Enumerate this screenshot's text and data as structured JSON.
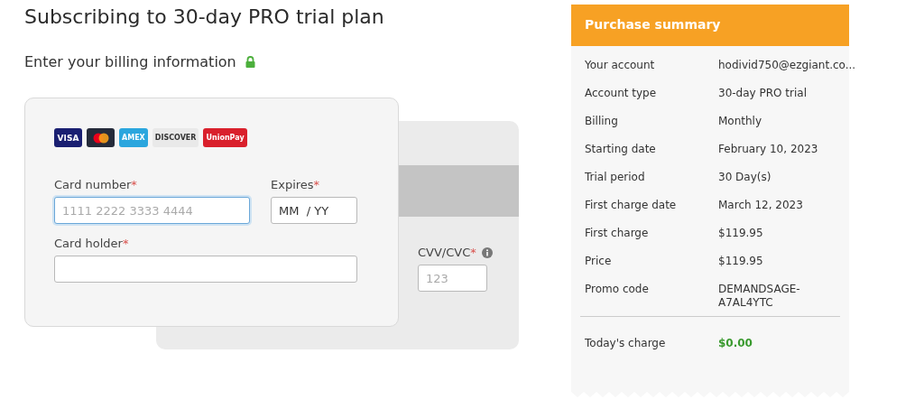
{
  "title": "Subscribing to 30-day PRO trial plan",
  "billing": {
    "heading": "Enter your billing information",
    "secure": true
  },
  "card_brands": [
    {
      "kind": "visa",
      "label": "VISA"
    },
    {
      "kind": "mastercard"
    },
    {
      "kind": "amex",
      "label": "AMEX"
    },
    {
      "kind": "discover",
      "label": "DISCOVER"
    },
    {
      "kind": "unionpay",
      "label": "UnionPay"
    }
  ],
  "fields": {
    "card_number": {
      "label": "Card number",
      "mark": "*",
      "placeholder": "1111 2222 3333 4444",
      "focused": true
    },
    "expires": {
      "label": "Expires",
      "mark": "*",
      "value": "MM  / YY",
      "focused": false
    },
    "card_holder": {
      "label": "Card holder",
      "mark": "*",
      "focused": false
    },
    "cvv": {
      "label": "CVV/CVC",
      "mark": "*",
      "placeholder": "123",
      "focused": false
    }
  },
  "summary": {
    "title": "Purchase summary",
    "rows": [
      {
        "label": "Your account",
        "value": "hodivid750@ezgiant.co..."
      },
      {
        "label": "Account type",
        "value": "30-day PRO trial"
      },
      {
        "label": "Billing",
        "value": "Monthly"
      },
      {
        "label": "Starting date",
        "value": "February 10, 2023"
      },
      {
        "label": "Trial period",
        "value": "30 Day(s)"
      },
      {
        "label": "First charge date",
        "value": "March 12, 2023"
      },
      {
        "label": "First charge",
        "value": "$119.95"
      },
      {
        "label": "Price",
        "value": "$119.95"
      },
      {
        "label": "Promo code",
        "value": "DEMANDSAGE-A7AL4YTC"
      }
    ],
    "total": {
      "label": "Today's charge",
      "value": "$0.00"
    }
  }
}
